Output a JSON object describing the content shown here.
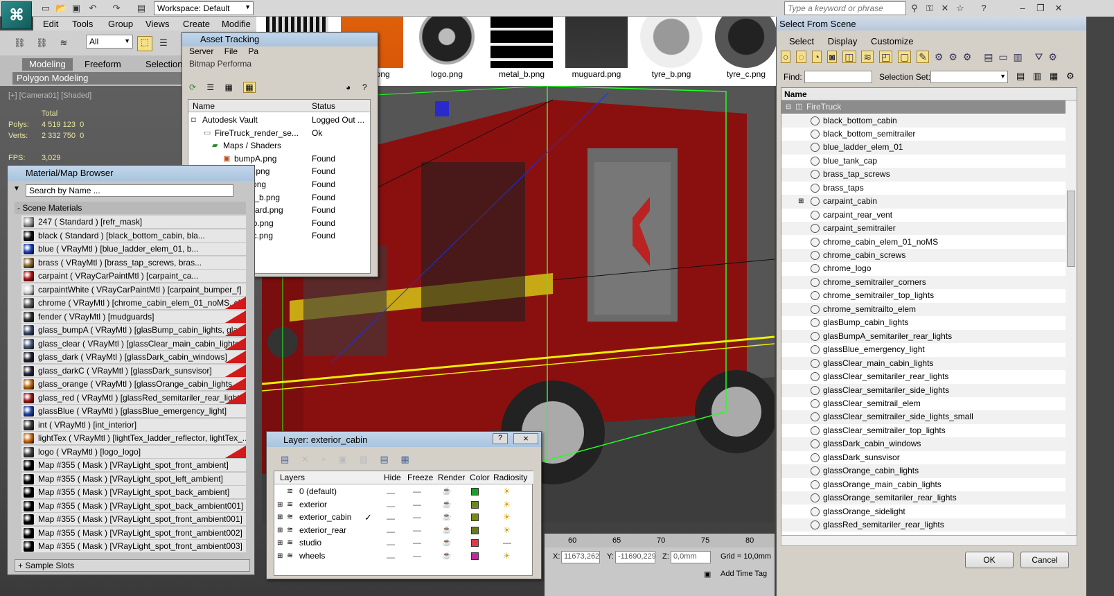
{
  "top": {
    "workspace": "Workspace: Default",
    "menus": [
      "Edit",
      "Tools",
      "Group",
      "Views",
      "Create",
      "Modifie"
    ],
    "selection_filter": "All",
    "ribbon_tabs": [
      "Modeling",
      "Freeform",
      "Selection"
    ],
    "ribbon_panel": "Polygon Modeling",
    "search_placeholder": "Type a keyword or phrase"
  },
  "viewport": {
    "label": "[+] [Camera01] [Shaded]",
    "total_label": "Total",
    "polys_label": "Polys:",
    "polys_value": "4 519 123",
    "polys_sel": "0",
    "verts_label": "Verts:",
    "verts_value": "2 332 750",
    "verts_sel": "0",
    "fps_label": "FPS:",
    "fps_value": "3,029"
  },
  "assets": [
    {
      "name": "bumpA.png"
    },
    {
      "name": "lights.png"
    },
    {
      "name": "logo.png"
    },
    {
      "name": "metal_b.png"
    },
    {
      "name": "muguard.png"
    },
    {
      "name": "tyre_b.png"
    },
    {
      "name": "tyre_c.png"
    }
  ],
  "asset_tracking": {
    "title": "Asset Tracking",
    "menus": [
      "Server",
      "File",
      "Pa"
    ],
    "submenu": "Bitmap Performa",
    "col_name": "Name",
    "col_status": "Status",
    "rows": [
      {
        "name": "Autodesk Vault",
        "status": "Logged Out ..."
      },
      {
        "name": "FireTruck_render_se...",
        "status": "Ok"
      },
      {
        "name": "Maps / Shaders",
        "status": ""
      },
      {
        "name": "bumpA.png",
        "status": "Found"
      },
      {
        "name": "lights.png",
        "status": "Found"
      },
      {
        "name": "logo.png",
        "status": "Found"
      },
      {
        "name": "metal_b.png",
        "status": "Found"
      },
      {
        "name": "muguard.png",
        "status": "Found"
      },
      {
        "name": "tyre_b.png",
        "status": "Found"
      },
      {
        "name": "tyre_c.png",
        "status": "Found"
      }
    ]
  },
  "material_browser": {
    "title": "Material/Map Browser",
    "search_placeholder": "Search by Name ...",
    "group": "- Scene Materials",
    "footer": "+ Sample Slots",
    "items": [
      {
        "label": "247  ( Standard ) [refr_mask]",
        "color": "#9a9a9a",
        "flag": false
      },
      {
        "label": "black  ( Standard ) [black_bottom_cabin, bla...",
        "color": "#111111",
        "flag": false
      },
      {
        "label": "blue  ( VRayMtl ) [blue_ladder_elem_01, b...",
        "color": "#1d3fb5",
        "flag": false
      },
      {
        "label": "brass  ( VRayMtl ) [brass_tap_screws, bras...",
        "color": "#8a6a30",
        "flag": false
      },
      {
        "label": "carpaint  ( VRayCarPaintMtl ) [carpaint_ca...",
        "color": "#b01515",
        "flag": false
      },
      {
        "label": "carpaintWhite  ( VRayCarPaintMtl ) [carpaint_bumper_f]",
        "color": "#d8d8d8",
        "flag": false
      },
      {
        "label": "chrome  ( VRayMtl ) [chrome_cabin_elem_01_noMS, chro...",
        "color": "#5a5a5a",
        "flag": true
      },
      {
        "label": "fender  ( VRayMtl ) [mudguards]",
        "color": "#303030",
        "flag": true
      },
      {
        "label": "glass_bumpA  ( VRayMtl ) [glasBump_cabin_lights, glasBu...",
        "color": "#3a4a6a",
        "flag": true
      },
      {
        "label": "glass_clear  ( VRayMtl ) [glassClear_main_cabin_lights, gl...",
        "color": "#4a5a7a",
        "flag": true
      },
      {
        "label": "glass_dark  ( VRayMtl ) [glassDark_cabin_windows]",
        "color": "#223",
        "flag": true
      },
      {
        "label": "glass_darkC  ( VRayMtl ) [glassDark_sunsvisor]",
        "color": "#2a2a3a",
        "flag": true
      },
      {
        "label": "glass_orange  ( VRayMtl ) [glassOrange_cabin_lights, glas...",
        "color": "#c06a10",
        "flag": true
      },
      {
        "label": "glass_red  ( VRayMtl ) [glassRed_semitariler_rear_lights]",
        "color": "#a01818",
        "flag": true
      },
      {
        "label": "glassBlue  ( VRayMtl ) [glassBlue_emergency_light]",
        "color": "#2244aa",
        "flag": false
      },
      {
        "label": "int  ( VRayMtl ) [int_interior]",
        "color": "#3a3a3a",
        "flag": false
      },
      {
        "label": "lightTex  ( VRayMtl ) [lightTex_ladder_reflector, lightTex_...",
        "color": "#d06a10",
        "flag": false
      },
      {
        "label": "logo  ( VRayMtl ) [logo_logo]",
        "color": "#444444",
        "flag": true
      },
      {
        "label": "Map #355  ( Mask ) [VRayLight_spot_front_ambient]",
        "color": "#000000",
        "flag": false
      },
      {
        "label": "Map #355  ( Mask ) [VRayLight_spot_left_ambient]",
        "color": "#000000",
        "flag": false
      },
      {
        "label": "Map #355  ( Mask ) [VRayLight_spot_back_ambient]",
        "color": "#000000",
        "flag": false
      },
      {
        "label": "Map #355  ( Mask ) [VRayLight_spot_back_ambient001]",
        "color": "#000000",
        "flag": false
      },
      {
        "label": "Map #355  ( Mask ) [VRayLight_spot_front_ambient001]",
        "color": "#000000",
        "flag": false
      },
      {
        "label": "Map #355  ( Mask ) [VRayLight_spot_front_ambient002]",
        "color": "#000000",
        "flag": false
      },
      {
        "label": "Map #355  ( Mask ) [VRayLight_spot_front_ambient003]",
        "color": "#000000",
        "flag": false
      }
    ]
  },
  "layer_window": {
    "title": "Layer: exterior_cabin",
    "help": "?",
    "close": "×",
    "headers": [
      "Layers",
      "Hide",
      "Freeze",
      "Render",
      "Color",
      "Radiosity"
    ],
    "rows": [
      {
        "name": "0 (default)",
        "expand": "",
        "check": "",
        "color": "#1aa02a"
      },
      {
        "name": "exterior",
        "expand": "⊞",
        "check": "",
        "color": "#6a8a1a"
      },
      {
        "name": "exterior_cabin",
        "expand": "⊞",
        "check": "✓",
        "color": "#7a8a10"
      },
      {
        "name": "exterior_rear",
        "expand": "⊞",
        "check": "",
        "color": "#6a7a1a"
      },
      {
        "name": "studio",
        "expand": "⊞",
        "check": "",
        "color": "#e03a4a"
      },
      {
        "name": "wheels",
        "expand": "⊞",
        "check": "",
        "color": "#c02aa0"
      }
    ]
  },
  "timeline": {
    "ticks": [
      "60",
      "65",
      "70",
      "75",
      "80"
    ]
  },
  "statusbar": {
    "x_label": "X:",
    "x_value": "11673,262",
    "y_label": "Y:",
    "y_value": "-11690,229",
    "z_label": "Z:",
    "z_value": "0,0mm",
    "grid": "Grid = 10,0mm",
    "add_time_tag": "Add Time Tag"
  },
  "scene_explorer": {
    "title": "Select From Scene",
    "menus": [
      "Select",
      "Display",
      "Customize"
    ],
    "find_label": "Find:",
    "selection_set_label": "Selection Set:",
    "col_name": "Name",
    "root": "FireTruck",
    "items": [
      "black_bottom_cabin",
      "black_bottom_semitrailer",
      "blue_ladder_elem_01",
      "blue_tank_cap",
      "brass_tap_screws",
      "brass_taps",
      "carpaint_cabin",
      "carpaint_rear_vent",
      "carpaint_semitrailer",
      "chrome_cabin_elem_01_noMS",
      "chrome_cabin_screws",
      "chrome_logo",
      "chrome_semitrailer_corners",
      "chrome_semitrailer_top_lights",
      "chrome_semitrailto_elem",
      "glasBump_cabin_lights",
      "glasBumpA_semitariler_rear_lights",
      "glassBlue_emergency_light",
      "glassClear_main_cabin_lights",
      "glassClear_semitariler_rear_lights",
      "glassClear_semitariler_side_lights",
      "glassClear_semitrail_elem",
      "glassClear_semitrailer_side_lights_small",
      "glassClear_semitrailer_top_lights",
      "glassDark_cabin_windows",
      "glassDark_sunsvisor",
      "glassOrange_cabin_lights",
      "glassOrange_main_cabin_lights",
      "glassOrange_semitariler_rear_lights",
      "glassOrange_sidelight",
      "glassRed_semitariler_rear_lights"
    ],
    "ok": "OK",
    "cancel": "Cancel"
  }
}
